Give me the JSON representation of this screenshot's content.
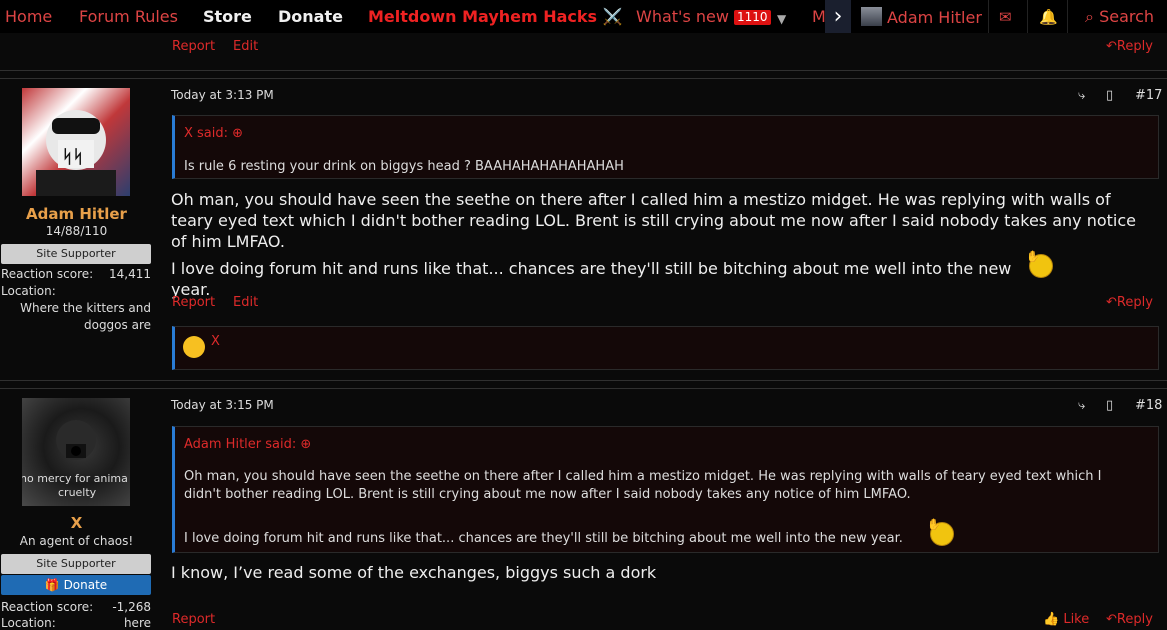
{
  "nav": {
    "items": [
      "Home",
      "Forum Rules",
      "Store",
      "Donate",
      "Meltdown Mayhem Hacks",
      "What's new",
      "M"
    ],
    "whats_new_badge": "1110",
    "hacks_emoji": "⚔️",
    "user": "Adam Hitler",
    "search": "Search"
  },
  "top_actions": {
    "report": "Report",
    "edit": "Edit",
    "reply": "Reply"
  },
  "posts": [
    {
      "user": {
        "name": "Adam Hitler",
        "title": "14/88/110",
        "banner": "Site Supporter",
        "reaction_label": "Reaction score:",
        "reaction_value": "14,411",
        "location_label": "Location:",
        "location_value": "Where the kitters and doggos are"
      },
      "time": "Today at 3:13 PM",
      "number": "#17",
      "quote": {
        "author": "X said:",
        "text": "Is rule 6 resting your drink on biggys head ? BAAHAHAHAHAHAHAH"
      },
      "body_1": "Oh man, you should have seen the seethe on there after I called him a mestizo midget. He was replying with walls of teary eyed text which I didn't bother reading LOL. Brent is still crying about me now after I said nobody takes any notice of him LMFAO.",
      "body_2": "I love doing forum hit and runs like that... chances are they'll still be bitching about me well into the new year.",
      "actions": {
        "report": "Report",
        "edit": "Edit",
        "reply": "Reply"
      },
      "reaction_user": "X"
    },
    {
      "user": {
        "name": "X",
        "title": "An agent of chaos!",
        "banner": "Site Supporter",
        "donate": "Donate",
        "reaction_label": "Reaction score:",
        "reaction_value": "-1,268",
        "location_label": "Location:",
        "location_value": "here",
        "avatar_caption": "no mercy for animal cruelty"
      },
      "time": "Today at 3:15 PM",
      "number": "#18",
      "quote": {
        "author": "Adam Hitler said:",
        "text_1": "Oh man, you should have seen the seethe on there after I called him a mestizo midget. He was replying with walls of teary eyed text which I didn't bother reading LOL. Brent is still crying about me now after I said nobody takes any notice of him LMFAO.",
        "text_2": "I love doing forum hit and runs like that... chances are they'll still be bitching about me well into the new year."
      },
      "body": "I know, I’ve read some of the exchanges, biggys such a dork",
      "actions": {
        "report": "Report",
        "like": "Like",
        "reply": "Reply"
      }
    }
  ],
  "colors": {
    "accent": "#dd2a2a",
    "quote_border": "#2a7bd4",
    "background": "#0a0a0a"
  }
}
